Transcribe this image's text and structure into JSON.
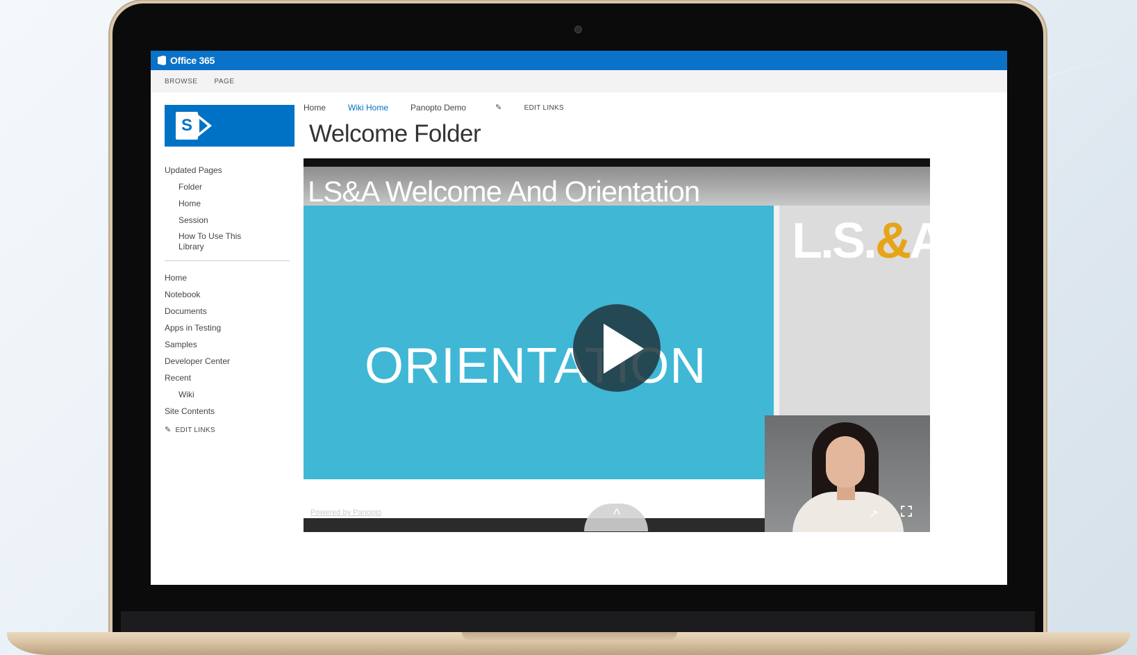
{
  "suite_bar": {
    "app_name": "Office 365"
  },
  "ribbon": {
    "tabs": [
      "BROWSE",
      "PAGE"
    ]
  },
  "logo": {
    "letter": "S"
  },
  "top_nav": {
    "items": [
      "Home",
      "Wiki Home",
      "Panopto Demo"
    ],
    "active_index": 1,
    "edit_links": "EDIT LINKS"
  },
  "page": {
    "title": "Welcome Folder"
  },
  "left_nav": {
    "section_title": "Updated Pages",
    "updated_pages": [
      "Folder",
      "Home",
      "Session",
      "How To Use This Library"
    ],
    "items": [
      {
        "label": "Home",
        "sub": false
      },
      {
        "label": "Notebook",
        "sub": false
      },
      {
        "label": "Documents",
        "sub": false
      },
      {
        "label": "Apps in Testing",
        "sub": false
      },
      {
        "label": "Samples",
        "sub": false
      },
      {
        "label": "Developer Center",
        "sub": false
      },
      {
        "label": "Recent",
        "sub": false
      },
      {
        "label": "Wiki",
        "sub": true
      },
      {
        "label": "Site Contents",
        "sub": false
      }
    ],
    "edit_links": "EDIT LINKS"
  },
  "video": {
    "title": "LS&A Welcome And Orientation",
    "slide_text": "ORIENTATION",
    "logo_parts": [
      "L.S.",
      "&",
      "A."
    ],
    "powered_by": "Powered by Panopto",
    "colors": {
      "slide_blue": "#3fb7d5",
      "logo_accent": "#e8a417"
    }
  },
  "colors": {
    "suite_bar": "#0a72c8",
    "brand_blue": "#0072c6"
  }
}
